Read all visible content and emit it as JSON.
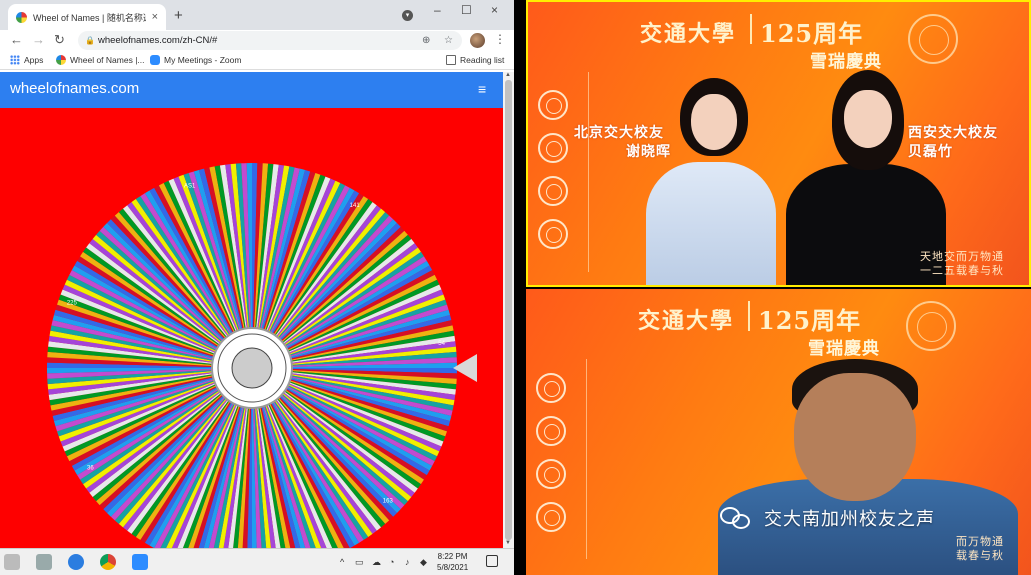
{
  "browser": {
    "tab_title": "Wheel of Names | 随机名称选择",
    "tab_close": "×",
    "new_tab": "+",
    "url": "wheelofnames.com/zh-CN/#",
    "win_min": "–",
    "win_max": "☐",
    "win_close": "×",
    "bookmarks": [
      {
        "label": "Apps"
      },
      {
        "label": "Wheel of Names |..."
      },
      {
        "label": "My Meetings - Zoom"
      }
    ],
    "reading_list": "Reading list"
  },
  "site": {
    "brand": "wheelofnames.com",
    "menu_glyph": "≡"
  },
  "wheel": {
    "colors": [
      "#3369e8",
      "#d50f25",
      "#eeb211",
      "#009925",
      "#e6e9ea",
      "#a445d8",
      "#f0f000",
      "#16a3a3",
      "#c24bd0",
      "#1f9ef0"
    ],
    "segment_count": 240,
    "pointer_color": "#d9d9d9",
    "labels": [
      "54",
      "163",
      "170",
      "36",
      "225",
      "AS1",
      "141"
    ],
    "center_logo": "Jiao Tong University seal"
  },
  "taskbar": {
    "time": "8:22 PM",
    "date": "5/8/2021"
  },
  "tiles": {
    "banner_title": "交通大學",
    "banner_number": "125周年",
    "banner_subtitle": "雪瑞慶典",
    "caption_left_1": "北京交大校友",
    "caption_left_2": "谢晓晖",
    "caption_right_1": "西安交大校友",
    "caption_right_2": "贝磊竹",
    "side_text_1": "天地交而万物通",
    "side_text_2": "一二五载春与秋",
    "side_text_3": "而万物通",
    "side_text_4": "载春与秋",
    "watermark": "交大南加州校友之声"
  }
}
